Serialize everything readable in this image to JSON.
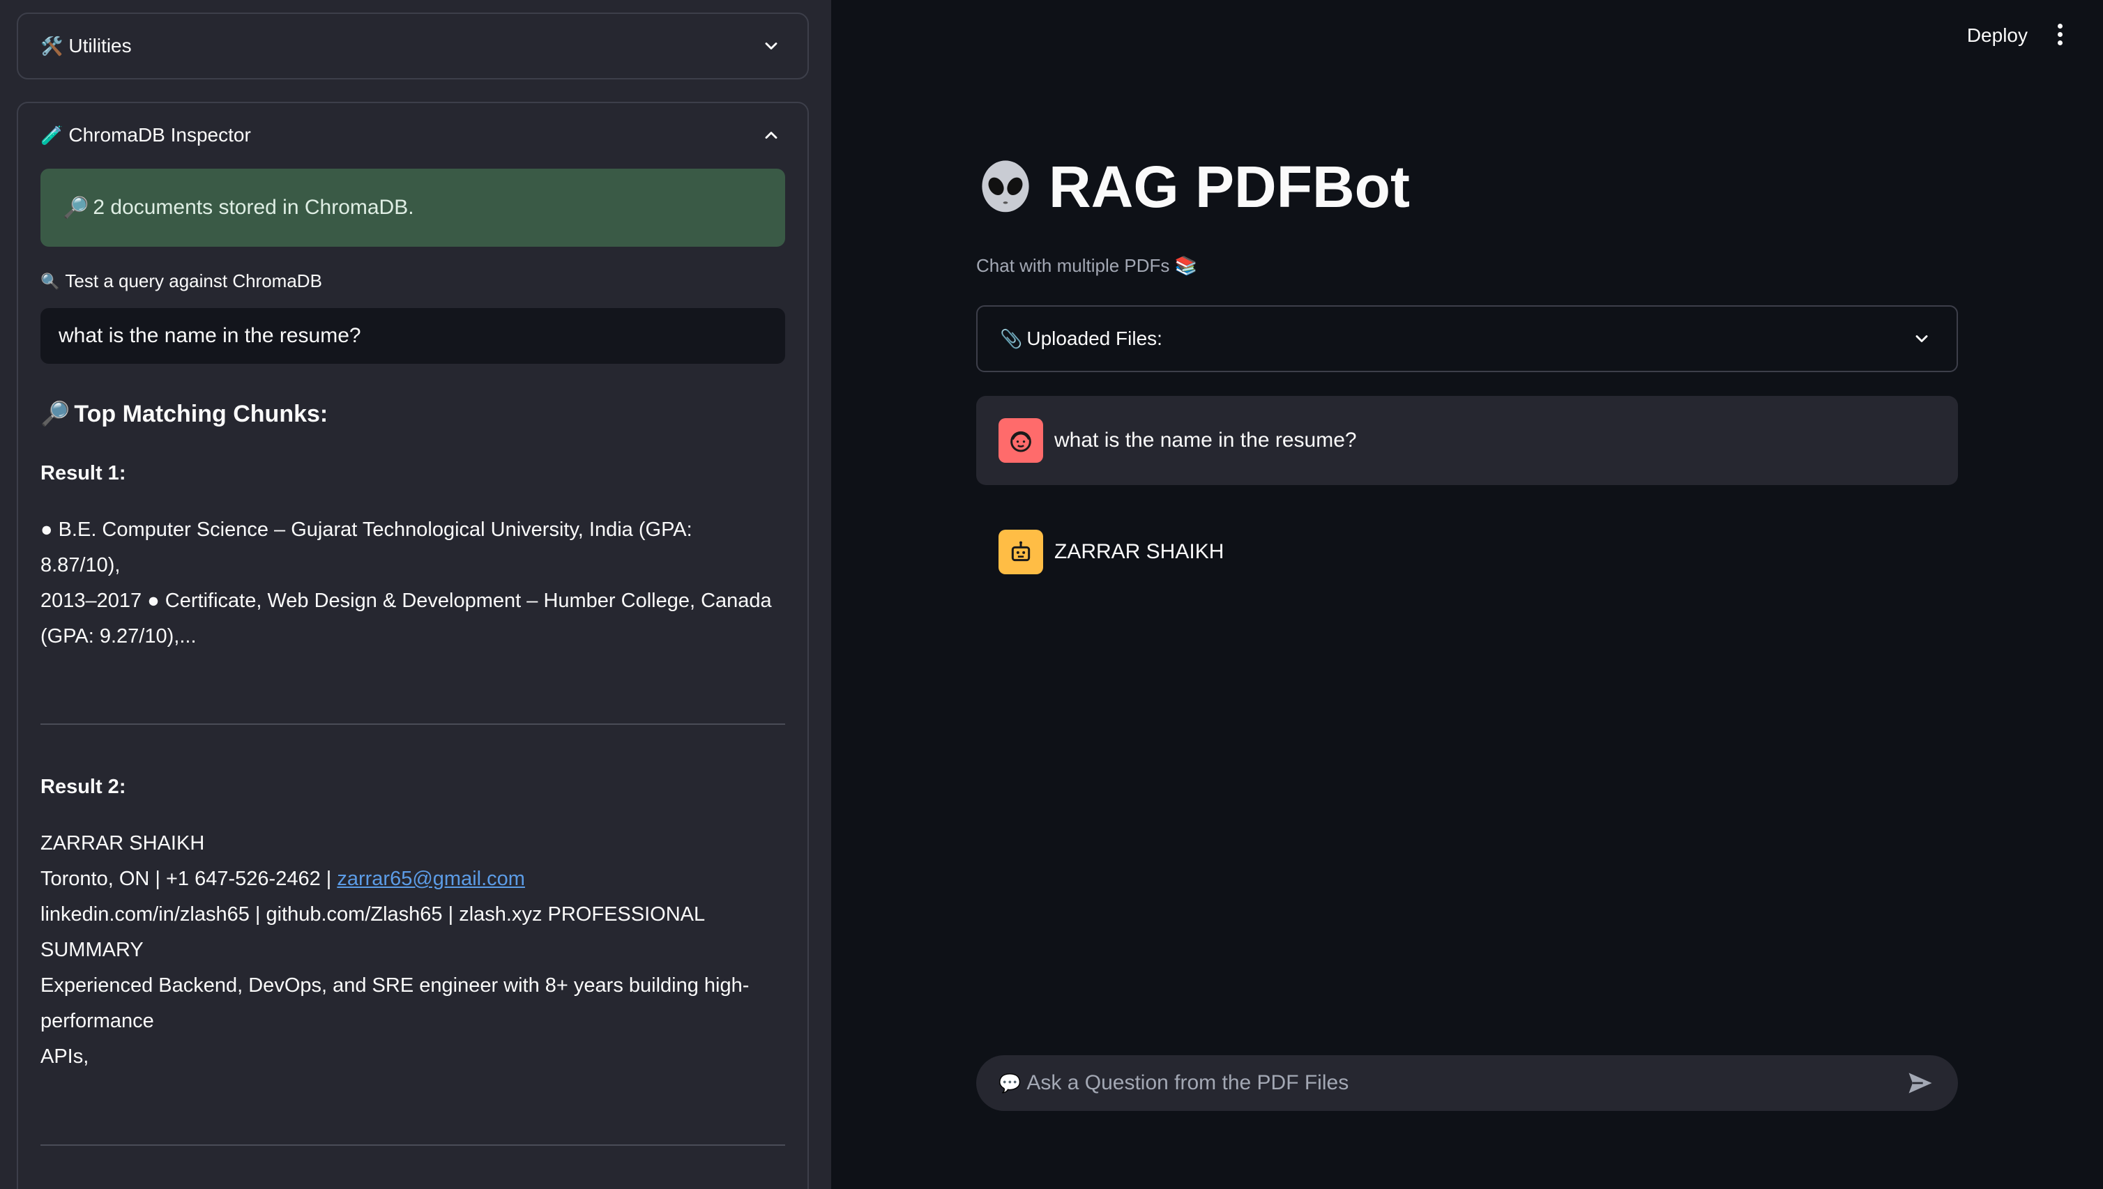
{
  "sidebar": {
    "utilities": {
      "icon": "hammer-wrench-icon",
      "label": "Utilities"
    },
    "chroma_inspector": {
      "icon": "test-tube-icon",
      "label": "ChromaDB Inspector",
      "status": "2 documents stored in ChromaDB.",
      "query_label": "Test a query against ChromaDB",
      "query_value": "what is the name in the resume?",
      "chunks_title": "Top Matching Chunks:",
      "results": [
        {
          "title": "Result 1:",
          "lines": [
            "● B.E. Computer Science – Gujarat Technological University, India (GPA:",
            "8.87/10),",
            "2013–2017 ● Certificate, Web Design & Development – Humber College, Canada",
            "(GPA: 9.27/10),..."
          ]
        },
        {
          "title": "Result 2:",
          "name_line": "ZARRAR SHAIKH",
          "contact_prefix": "Toronto, ON | +1 647-526-2462 | ",
          "email": "zarrar65@gmail.com",
          "lines": [
            "linkedin.com/in/zlash65 | github.com/Zlash65 | zlash.xyz PROFESSIONAL",
            "SUMMARY",
            "Experienced Backend, DevOps, and SRE engineer with 8+ years building high-",
            "performance",
            "APIs,"
          ]
        }
      ]
    }
  },
  "header": {
    "deploy_label": "Deploy"
  },
  "main": {
    "title_icon": "alien-icon",
    "title": "RAG PDFBot",
    "caption": "Chat with multiple PDFs 📚",
    "uploads_label": "Uploaded Files:",
    "messages": [
      {
        "role": "user",
        "text": "what is the name in the resume?"
      },
      {
        "role": "assistant",
        "text": "ZARRAR SHAIKH"
      }
    ],
    "chat_placeholder": "Ask a Question from the PDF Files"
  },
  "colors": {
    "background": "#0e1117",
    "sidebar": "#262730",
    "success": "#3a5a46",
    "link": "#5c9ce6",
    "user_avatar": "#ff6b6b",
    "bot_avatar": "#ffbd45"
  }
}
